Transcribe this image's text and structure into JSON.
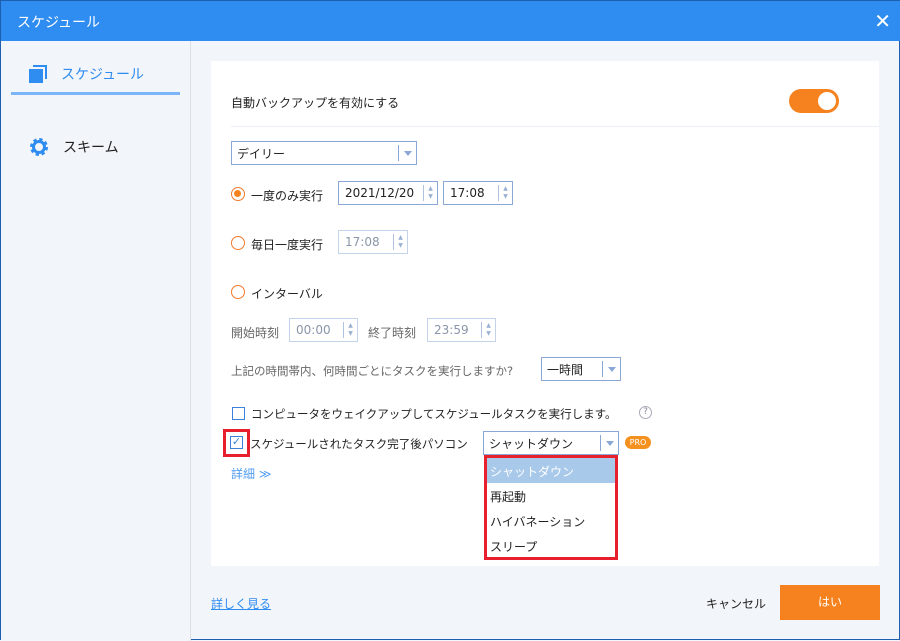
{
  "window": {
    "title": "スケジュール"
  },
  "sidebar": {
    "items": [
      {
        "label": "スケジュール"
      },
      {
        "label": "スキーム"
      }
    ]
  },
  "main": {
    "auto_backup_label": "自動バックアップを有効にする",
    "auto_backup_enabled": true,
    "frequency": "デイリー",
    "once": {
      "label": "一度のみ実行",
      "date": "2021/12/20",
      "time": "17:08",
      "selected": true
    },
    "daily": {
      "label": "毎日一度実行",
      "time": "17:08"
    },
    "interval": {
      "label": "インターバル",
      "start_label": "開始時刻",
      "start": "00:00",
      "end_label": "終了時刻",
      "end": "23:59",
      "question": "上記の時間帯内、何時間ごとにタスクを実行しますか?",
      "every": "一時間"
    },
    "wake": {
      "label": "コンピュータをウェイクアップしてスケジュールタスクを実行します。",
      "checked": false,
      "help": "?"
    },
    "after": {
      "label": "スケジュールされたタスク完了後パソコン",
      "checked": true,
      "value": "シャットダウン",
      "badge": "PRO"
    },
    "dropdown_options": [
      "シャットダウン",
      "再起動",
      "ハイバネーション",
      "スリープ"
    ],
    "details": "詳細 ≫"
  },
  "footer": {
    "learn_more": "詳しく見る",
    "cancel": "キャンセル",
    "ok": "はい"
  },
  "colors": {
    "accent": "#2f8cf0",
    "orange": "#f5821f",
    "highlight": "#e8202e"
  }
}
